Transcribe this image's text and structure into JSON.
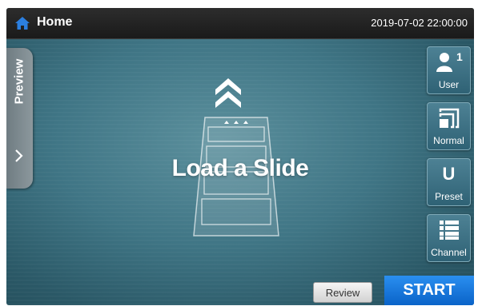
{
  "header": {
    "home_icon": "home-icon",
    "title": "Home",
    "datetime": "2019-07-02 22:00:00"
  },
  "preview_tab": {
    "label": "Preview",
    "icon": "chevron-right-icon"
  },
  "main": {
    "up_icon": "double-chevron-up-icon",
    "tray_icon": "slide-tray-icon",
    "message": "Load a Slide"
  },
  "side_buttons": [
    {
      "label": "User",
      "icon": "user-icon",
      "count": "1"
    },
    {
      "label": "Normal",
      "icon": "normal-mode-icon"
    },
    {
      "label": "Preset",
      "icon": "preset-icon",
      "glyph": "U"
    },
    {
      "label": "Channel",
      "icon": "channel-list-icon"
    }
  ],
  "footer": {
    "review_label": "Review",
    "start_label": "START"
  },
  "colors": {
    "topbar": "#1f1f1f",
    "background": "#3f7585",
    "start_button": "#1479e0",
    "home_icon": "#2b7fe0"
  }
}
